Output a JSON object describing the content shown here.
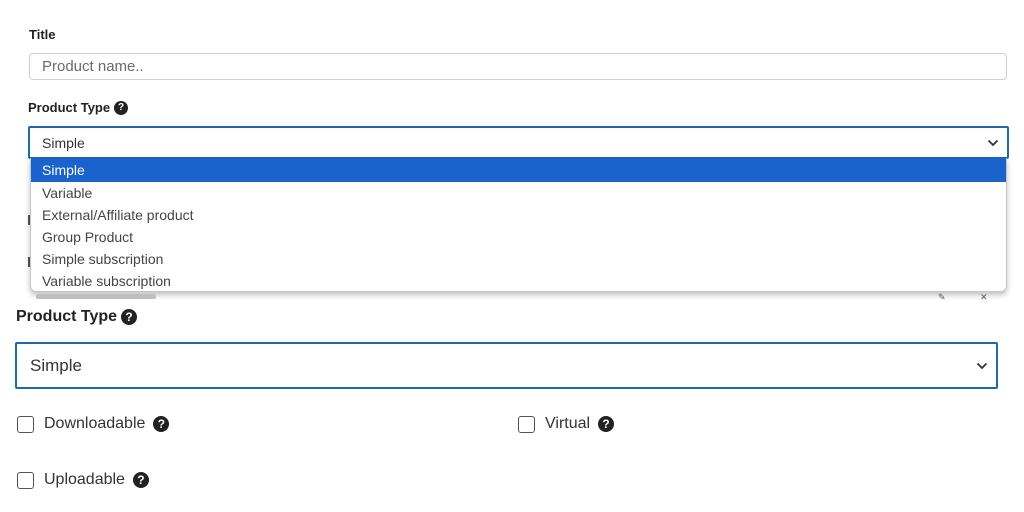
{
  "top": {
    "title_label": "Title",
    "title_placeholder": "Product name..",
    "product_type_label": "Product Type",
    "selected_value": "Simple",
    "options": [
      "Simple",
      "Variable",
      "External/Affiliate product",
      "Group Product",
      "Simple subscription",
      "Variable subscription"
    ],
    "selected_index": 0
  },
  "bottom": {
    "product_type_label": "Product Type",
    "selected_value": "Simple",
    "checkboxes": {
      "downloadable": {
        "label": "Downloadable",
        "checked": false
      },
      "virtual": {
        "label": "Virtual",
        "checked": false
      },
      "uploadable": {
        "label": "Uploadable",
        "checked": false
      }
    }
  },
  "icons": {
    "help": "question-circle-icon",
    "chevron": "chevron-down-icon"
  },
  "colors": {
    "select_border": "#1e6aa8",
    "option_highlight": "#1a62cc",
    "help_icon": "#222222"
  }
}
